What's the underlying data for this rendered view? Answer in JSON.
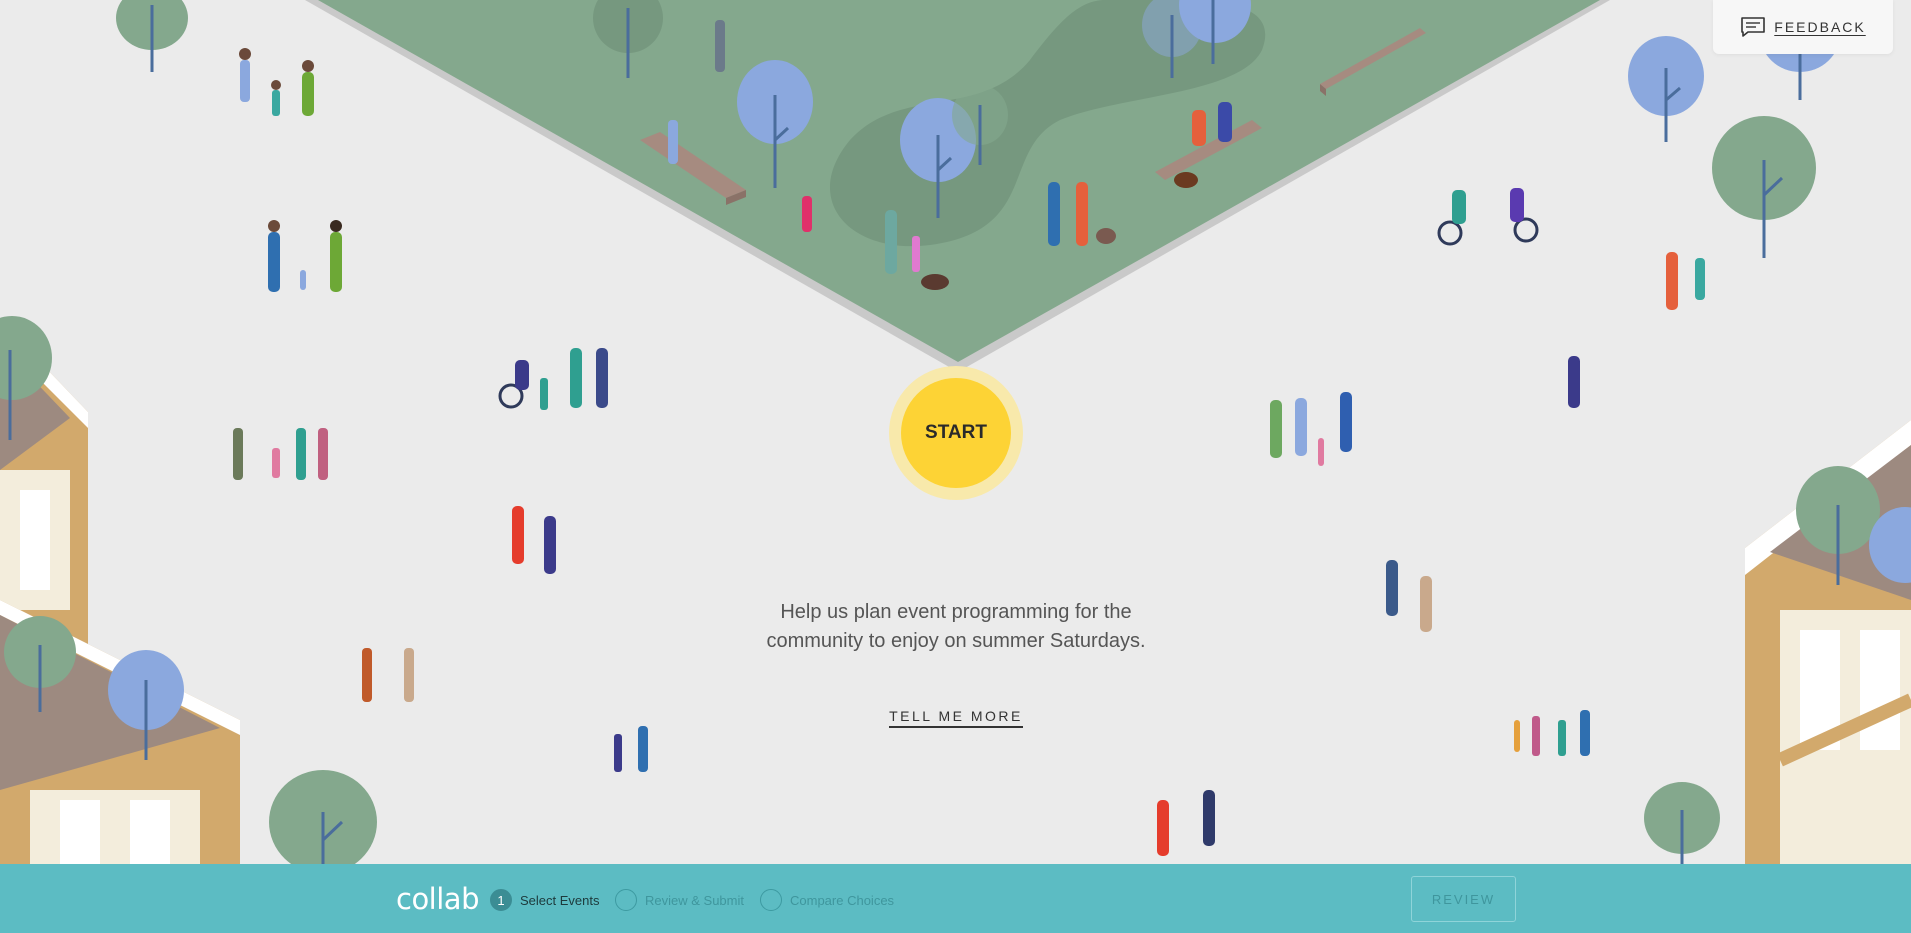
{
  "feedback": {
    "label": "FEEDBACK",
    "icon": "feedback-icon"
  },
  "hero": {
    "start_label": "START",
    "intro_text": "Help us plan event programming for the community to enjoy on summer Saturdays.",
    "tell_more_label": "TELL ME MORE"
  },
  "footer": {
    "logo": "collab",
    "steps": [
      {
        "number": "1",
        "label": "Select Events",
        "state": "active"
      },
      {
        "number": "",
        "label": "Review & Submit",
        "state": "inactive"
      },
      {
        "number": "",
        "label": "Compare Choices",
        "state": "inactive"
      }
    ],
    "review_label": "REVIEW"
  },
  "colors": {
    "background": "#ebebeb",
    "park_green": "#84a88d",
    "start_yellow": "#fdd335",
    "footer_teal": "#5cbcc3",
    "tree_green": "#84a88d",
    "tree_blue": "#8ba8de",
    "building_wood": "#d2a96c",
    "roof_brown": "#9d8a80"
  }
}
